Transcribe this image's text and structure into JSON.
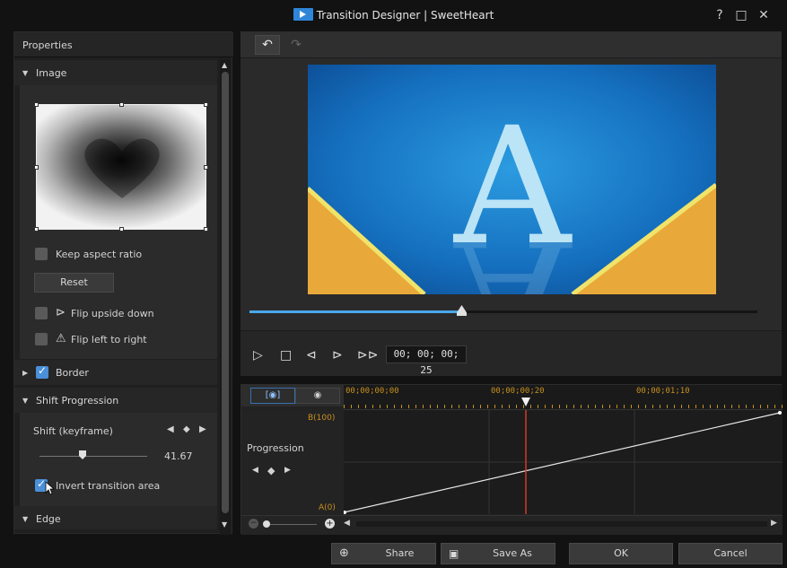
{
  "window": {
    "title": "Transition Designer | SweetHeart",
    "help": "?",
    "maximize": "□",
    "close": "✕"
  },
  "properties": {
    "header": "Properties",
    "sections": {
      "image": "Image",
      "border": "Border",
      "shift_progression": "Shift Progression",
      "edge": "Edge"
    },
    "keep_aspect_ratio": "Keep aspect ratio",
    "reset": "Reset",
    "flip_upside_down": "Flip upside down",
    "flip_left_to_right": "Flip left to right",
    "shift_keyframe": "Shift (keyframe)",
    "shift_value": "41.67",
    "invert_transition_area": "Invert transition area",
    "border_checked": true,
    "invert_checked": true
  },
  "player": {
    "timecode": "00; 00; 00; 25",
    "progress": 0.43
  },
  "timeline": {
    "tabs": [
      "[◉]",
      "◉"
    ],
    "ruler": [
      "00;00;00;00",
      "00;00;00;20",
      "00;00;01;10"
    ],
    "track": "Progression",
    "y_top": "B(100)",
    "y_bottom": "A(0)"
  },
  "buttons": {
    "share": "Share",
    "save_as": "Save As",
    "ok": "OK",
    "cancel": "Cancel"
  },
  "colors": {
    "accent": "#4a90d9",
    "timecode": "#c7901e",
    "playhead": "#d23a2a"
  }
}
